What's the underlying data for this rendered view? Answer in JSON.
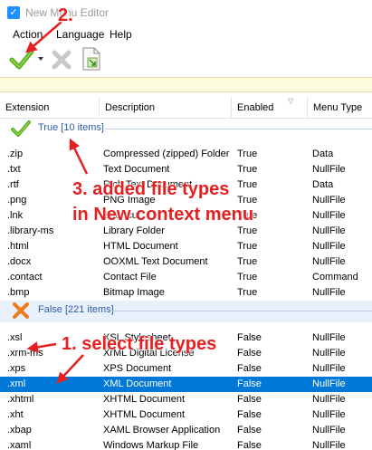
{
  "window": {
    "title": "New Menu Editor"
  },
  "menu": {
    "items": [
      "Action",
      "Language",
      "Help"
    ]
  },
  "columns": [
    "Extension",
    "Description",
    "Enabled",
    "Menu Type"
  ],
  "groups": {
    "true": {
      "title": "True [10 items]"
    },
    "false": {
      "title": "False [221 items]"
    }
  },
  "true_rows": [
    [
      ".zip",
      "Compressed (zipped) Folder",
      "True",
      "Data"
    ],
    [
      ".txt",
      "Text Document",
      "True",
      "NullFile"
    ],
    [
      ".rtf",
      "Rich Text Document",
      "True",
      "Data"
    ],
    [
      ".png",
      "PNG Image",
      "True",
      "NullFile"
    ],
    [
      ".lnk",
      "Shortcut",
      "True",
      "NullFile"
    ],
    [
      ".library-ms",
      "Library Folder",
      "True",
      "NullFile"
    ],
    [
      ".html",
      "HTML Document",
      "True",
      "NullFile"
    ],
    [
      ".docx",
      "OOXML Text Document",
      "True",
      "NullFile"
    ],
    [
      ".contact",
      "Contact File",
      "True",
      "Command"
    ],
    [
      ".bmp",
      "Bitmap Image",
      "True",
      "NullFile"
    ]
  ],
  "false_rows": [
    [
      ".xsl",
      "XSL Stylesheet",
      "False",
      "NullFile"
    ],
    [
      ".xrm-ms",
      "XrML Digital License",
      "False",
      "NullFile"
    ],
    [
      ".xps",
      "XPS Document",
      "False",
      "NullFile"
    ],
    [
      ".xml",
      "XML Document",
      "False",
      "NullFile"
    ],
    [
      ".xhtml",
      "XHTML Document",
      "False",
      "NullFile"
    ],
    [
      ".xht",
      "XHTML Document",
      "False",
      "NullFile"
    ],
    [
      ".xbap",
      "XAML Browser Application",
      "False",
      "NullFile"
    ],
    [
      ".xaml",
      "Windows Markup File",
      "False",
      "NullFile"
    ]
  ],
  "selected_row": 3,
  "annotations": {
    "step2": "2.",
    "step3_line1": "3. added file types",
    "step3_line2": "in New context menu",
    "step1": "1. select file types"
  },
  "colors": {
    "selection": "#0078d7",
    "group_title": "#2a5ea8",
    "annotation": "#e62020",
    "search_bg": "#fffde0"
  },
  "icons": {
    "toolbar": [
      "check-icon",
      "dropdown-arrow-icon",
      "x-icon",
      "export-document-icon"
    ],
    "group_true": "check-icon",
    "group_false": "x-icon"
  }
}
